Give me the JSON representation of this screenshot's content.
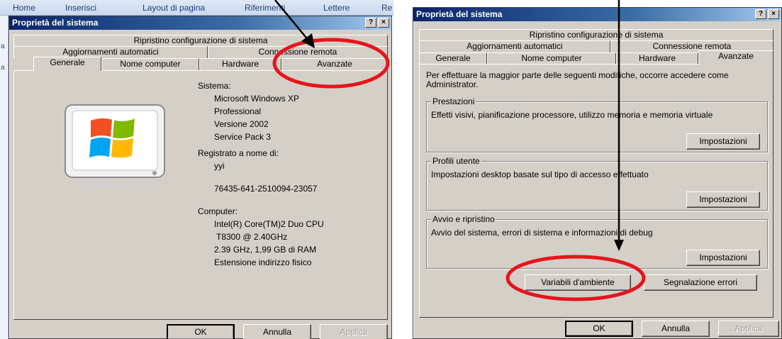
{
  "word_ribbon": {
    "tabs": [
      "Home",
      "Inserisci",
      "Layout di pagina",
      "Riferimenti",
      "Lettere",
      "Re"
    ],
    "side_letters": [
      "a",
      "a"
    ]
  },
  "left_dialog": {
    "title": "Proprietà del sistema",
    "title_buttons": [
      "?",
      "×"
    ],
    "tabs_row1": [
      "Ripristino configurazione di sistema"
    ],
    "tabs_row2": [
      "Aggiornamenti automatici",
      "Connessione remota"
    ],
    "tabs_row3": [
      "Generale",
      "Nome computer",
      "Hardware",
      "Avanzate"
    ],
    "active_tab": "Generale",
    "system": {
      "label": "Sistema:",
      "lines": [
        "Microsoft Windows XP",
        "Professional",
        "Versione 2002",
        "Service Pack 3"
      ]
    },
    "registered": {
      "label": "Registrato a nome di:",
      "lines": [
        "yyi",
        "76435-641-2510094-23057"
      ]
    },
    "computer": {
      "label": "Computer:",
      "lines": [
        "Intel(R) Core(TM)2 Duo CPU",
        "T8300  @ 2.40GHz",
        "2.39 GHz, 1,99 GB di RAM",
        "Estensione indirizzo fisico"
      ]
    },
    "buttons": {
      "ok": "OK",
      "cancel": "Annulla",
      "apply": "Applica"
    }
  },
  "right_dialog": {
    "title": "Proprietà del sistema",
    "title_buttons": [
      "?",
      "×"
    ],
    "tabs_row1": [
      "Ripristino configurazione di sistema"
    ],
    "tabs_row2": [
      "Aggiornamenti automatici",
      "Connessione remota"
    ],
    "tabs_row3": [
      "Generale",
      "Nome computer",
      "Hardware",
      "Avanzate"
    ],
    "active_tab": "Avanzate",
    "intro": "Per effettuare la maggior parte delle seguenti modifiche, occorre accedere come Administrator.",
    "groups": [
      {
        "legend": "Prestazioni",
        "text": "Effetti visivi, pianificazione processore, utilizzo memoria e memoria virtuale",
        "button": "Impostazioni"
      },
      {
        "legend": "Profili utente",
        "text": "Impostazioni desktop basate sul tipo di accesso effettuato",
        "button": "Impostazioni"
      },
      {
        "legend": "Avvio e ripristino",
        "text": "Avvio del sistema, errori di sistema e informazioni di debug",
        "button": "Impostazioni"
      }
    ],
    "env_button": "Variabili d'ambiente",
    "error_button": "Segnalazione errori",
    "buttons": {
      "ok": "OK",
      "cancel": "Annulla",
      "apply": "Applica"
    }
  },
  "annotations": {
    "color": "#e8141b",
    "arrow_color": "#000000"
  }
}
